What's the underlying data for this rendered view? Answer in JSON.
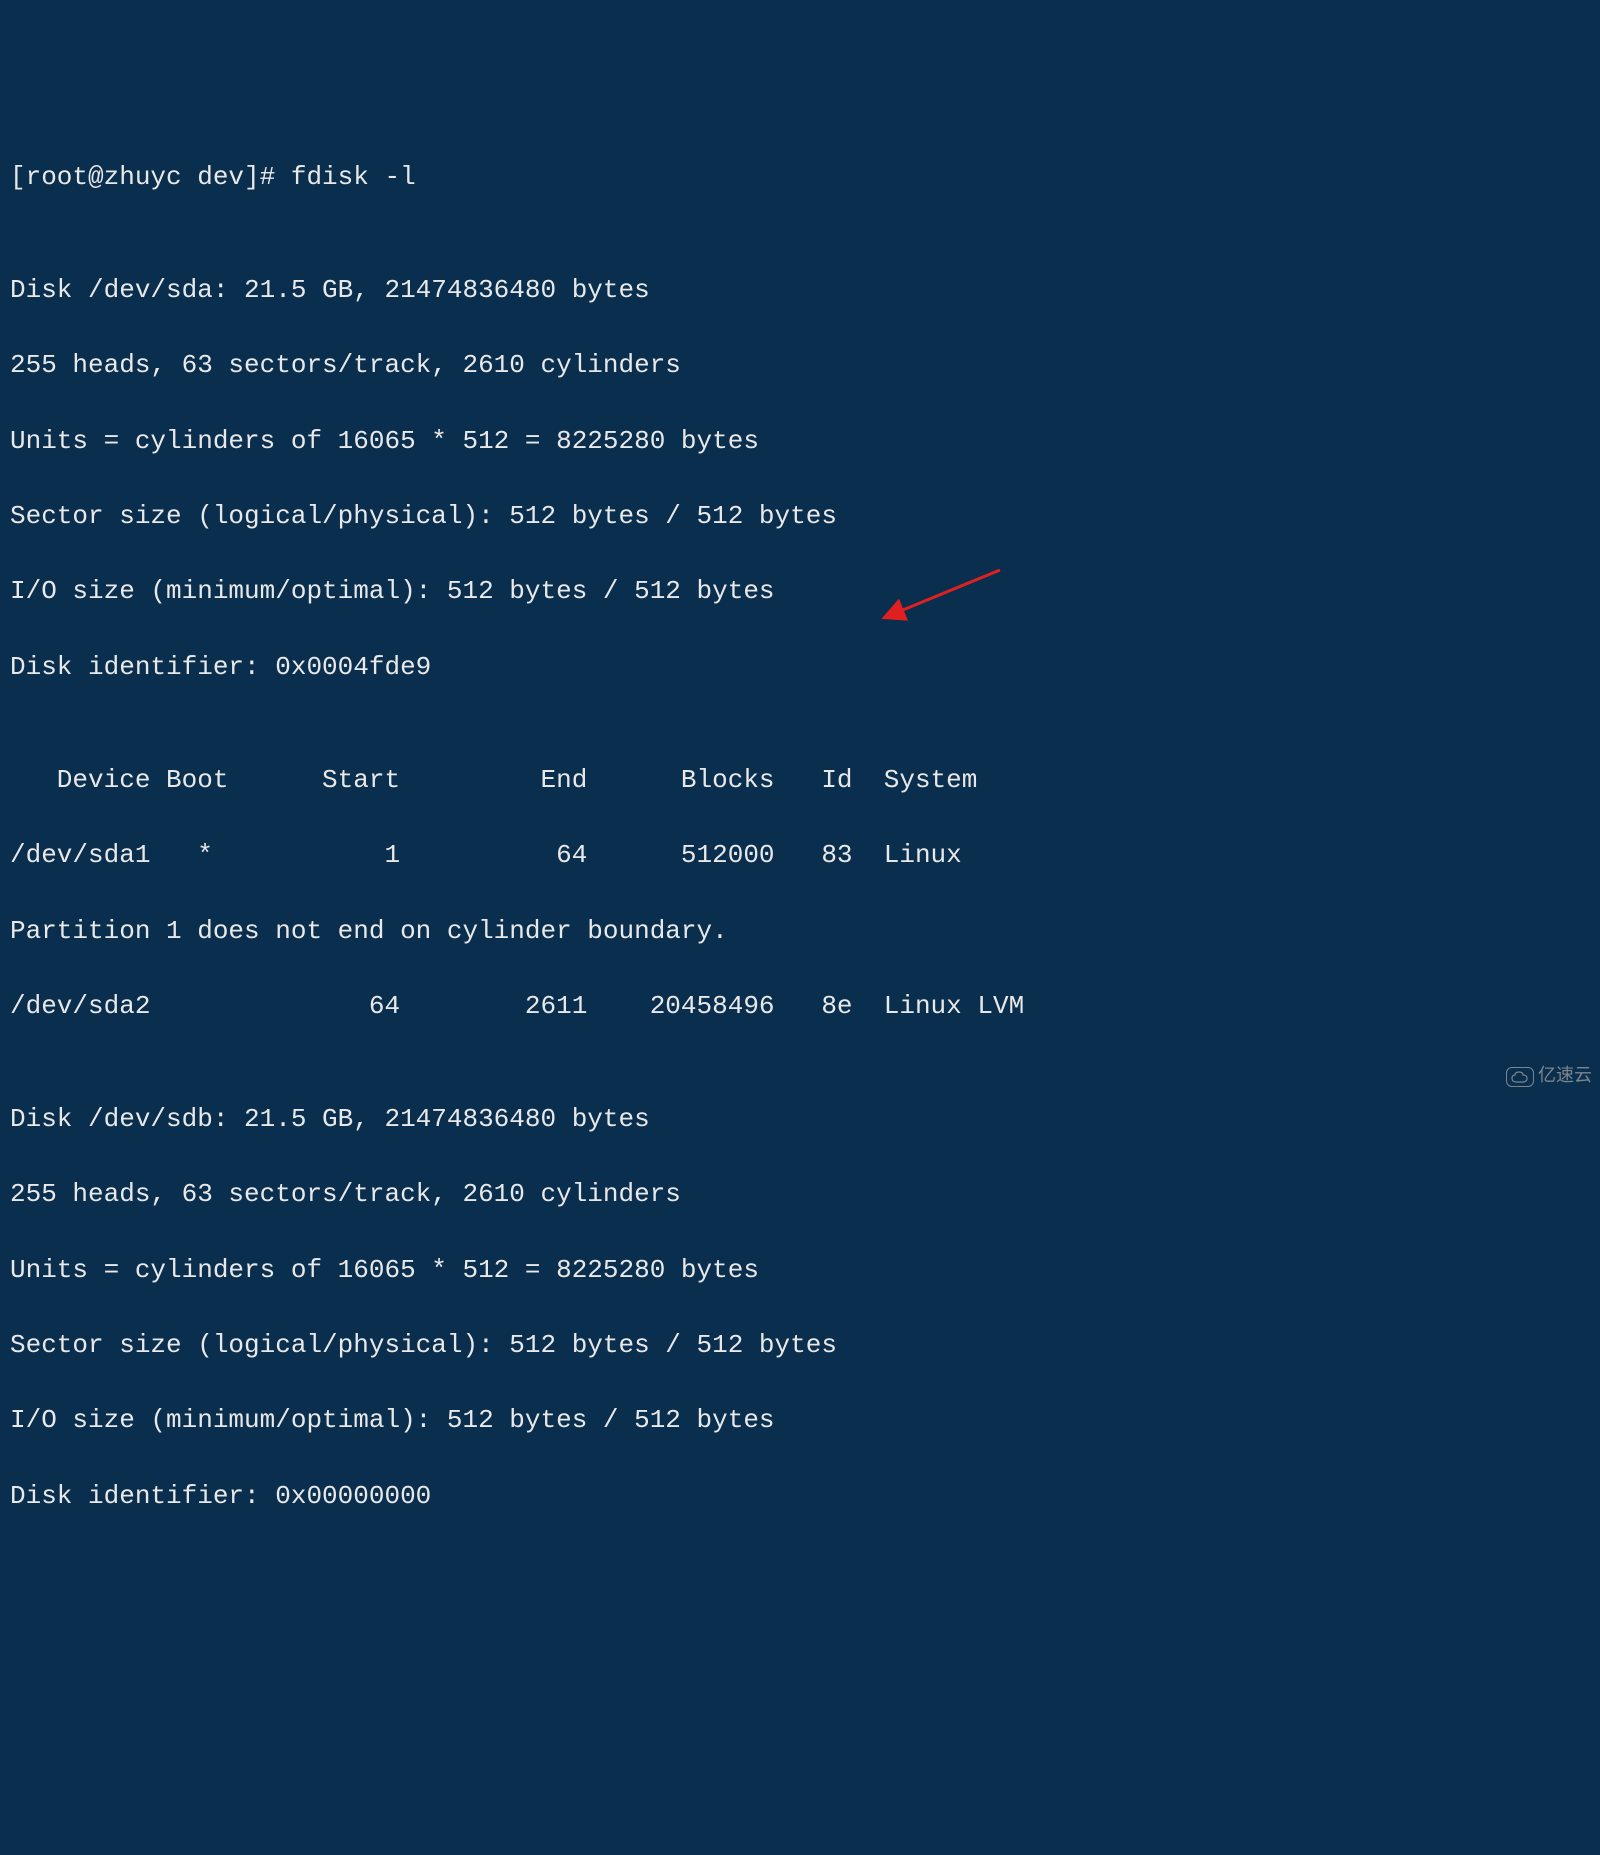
{
  "prompt": "[root@zhuyc dev]# fdisk -l",
  "blank1": "",
  "disk_a": {
    "header": "Disk /dev/sda: 21.5 GB, 21474836480 bytes",
    "geometry": "255 heads, 63 sectors/track, 2610 cylinders",
    "units": "Units = cylinders of 16065 * 512 = 8225280 bytes",
    "sector_size": "Sector size (logical/physical): 512 bytes / 512 bytes",
    "io_size": "I/O size (minimum/optimal): 512 bytes / 512 bytes",
    "identifier": "Disk identifier: 0x0004fde9"
  },
  "blank2": "",
  "table": {
    "header": "   Device Boot      Start         End      Blocks   Id  System",
    "row1": "/dev/sda1   *           1          64      512000   83  Linux",
    "warning": "Partition 1 does not end on cylinder boundary.",
    "row2": "/dev/sda2              64        2611    20458496   8e  Linux LVM"
  },
  "blank3": "",
  "disk_b": {
    "header": "Disk /dev/sdb: 21.5 GB, 21474836480 bytes",
    "geometry": "255 heads, 63 sectors/track, 2610 cylinders",
    "units": "Units = cylinders of 16065 * 512 = 8225280 bytes",
    "sector_size": "Sector size (logical/physical): 512 bytes / 512 bytes",
    "io_size": "I/O size (minimum/optimal): 512 bytes / 512 bytes",
    "identifier": "Disk identifier: 0x00000000"
  },
  "watermark": {
    "text": "亿速云"
  }
}
